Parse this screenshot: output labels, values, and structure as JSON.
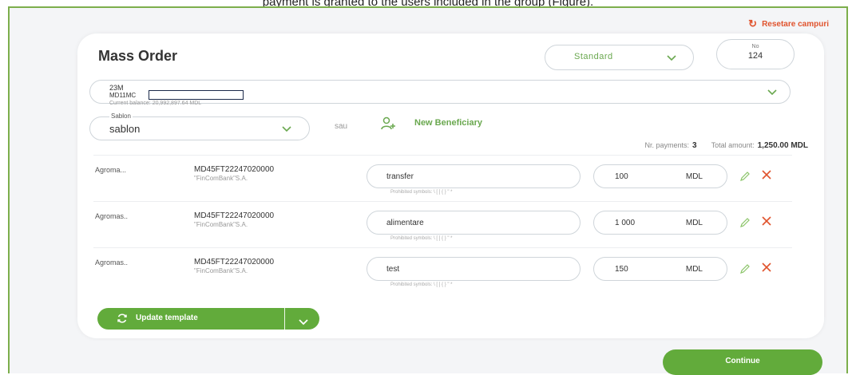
{
  "top_caption": "payment is granted to the users included in the group (Figure).",
  "reset_label": "Resetare campuri",
  "title": "Mass Order",
  "type_select": {
    "value": "Standard"
  },
  "number": {
    "label": "No",
    "value": "124"
  },
  "account": {
    "line1": "23M",
    "line2": "MD11MC",
    "balance": "Current balance: 20,992,897.64 MDL"
  },
  "template": {
    "label": "Sablon",
    "value": "sablon"
  },
  "or_text": "sau",
  "new_beneficiary": "New Beneficiary",
  "summary": {
    "payments_label": "Nr. payments:",
    "payments_value": "3",
    "total_label": "Total amount:",
    "total_value": "1,250.00 MDL"
  },
  "rows": [
    {
      "name": "Agroma...",
      "iban": "MD45FT22247020000",
      "bank": "\"FinComBank\"S.A.",
      "purpose": "transfer",
      "prohibited": "Prohibited symbols: \\ [ ] { } \" *",
      "amount": "100",
      "currency": "MDL"
    },
    {
      "name": "Agromas..",
      "iban": "MD45FT22247020000",
      "bank": "\"FinComBank\"S.A.",
      "purpose": "alimentare",
      "prohibited": "Prohibited symbols: \\ [ ] { } \" *",
      "amount": "1 000",
      "currency": "MDL"
    },
    {
      "name": "Agromas..",
      "iban": "MD45FT22247020000",
      "bank": "\"FinComBank\"S.A.",
      "purpose": "test",
      "prohibited": "Prohibited symbols: \\ [ ] { } \" *",
      "amount": "150",
      "currency": "MDL"
    }
  ],
  "update_template": "Update template",
  "continue": "Continue",
  "colors": {
    "accent": "#62ab3b",
    "danger": "#e0532d",
    "border": "#7cae4b"
  }
}
